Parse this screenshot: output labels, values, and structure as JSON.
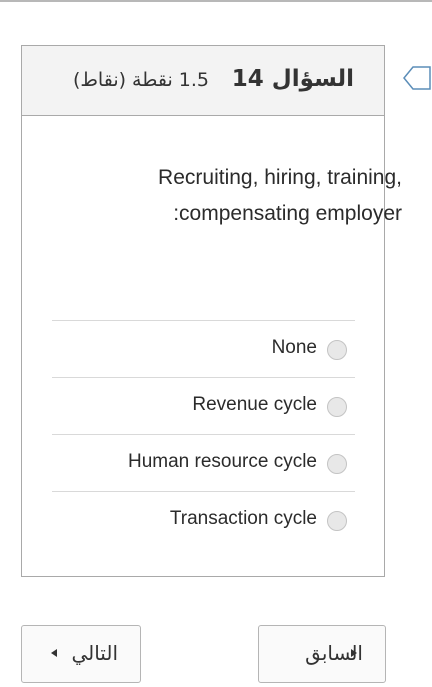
{
  "question": {
    "title": "السؤال 14",
    "points": "1.5 نقطة (نقاط)",
    "text_line1": "Recruiting, hiring, training,",
    "text_line2": ":compensating employer",
    "options": [
      {
        "label": "None"
      },
      {
        "label": "Revenue cycle"
      },
      {
        "label": "Human resource cycle"
      },
      {
        "label": "Transaction cycle"
      }
    ]
  },
  "navigation": {
    "next_label": "التالي",
    "prev_label": "السابق"
  },
  "icons": {
    "flag": "flag-icon",
    "next_arrow": "triangle-left-icon",
    "prev_arrow": "triangle-right-icon"
  },
  "colors": {
    "header_bg": "#f3f3f3",
    "border": "#a9a9a9",
    "radio_fill": "#e8e8e8"
  }
}
